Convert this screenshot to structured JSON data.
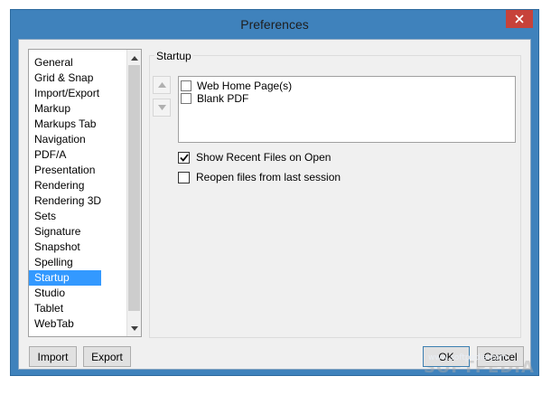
{
  "window": {
    "title": "Preferences",
    "close_glyph": "✕"
  },
  "sidebar": {
    "items": [
      {
        "label": "General",
        "selected": false
      },
      {
        "label": "Grid & Snap",
        "selected": false
      },
      {
        "label": "Import/Export",
        "selected": false
      },
      {
        "label": "Markup",
        "selected": false
      },
      {
        "label": "Markups Tab",
        "selected": false
      },
      {
        "label": "Navigation",
        "selected": false
      },
      {
        "label": "PDF/A",
        "selected": false
      },
      {
        "label": "Presentation",
        "selected": false
      },
      {
        "label": "Rendering",
        "selected": false
      },
      {
        "label": "Rendering 3D",
        "selected": false
      },
      {
        "label": "Sets",
        "selected": false
      },
      {
        "label": "Signature",
        "selected": false
      },
      {
        "label": "Snapshot",
        "selected": false
      },
      {
        "label": "Spelling",
        "selected": false
      },
      {
        "label": "Startup",
        "selected": true
      },
      {
        "label": "Studio",
        "selected": false
      },
      {
        "label": "Tablet",
        "selected": false
      },
      {
        "label": "WebTab",
        "selected": false
      }
    ]
  },
  "footer": {
    "import_label": "Import",
    "export_label": "Export",
    "ok_label": "OK",
    "cancel_label": "Cancel"
  },
  "startup": {
    "group_title": "Startup",
    "open_items": [
      {
        "label": "Web Home Page(s)",
        "checked": false
      },
      {
        "label": "Blank PDF",
        "checked": false
      }
    ],
    "show_recent_label": "Show Recent Files on Open",
    "show_recent_checked": true,
    "reopen_label": "Reopen files from last session",
    "reopen_checked": false
  },
  "colors": {
    "title_bar": "#3f82bc",
    "close_button": "#c7423a",
    "selection": "#3399ff"
  },
  "watermark": {
    "text": "SOFTPEDIA",
    "sub": "www.softpedia.com"
  }
}
